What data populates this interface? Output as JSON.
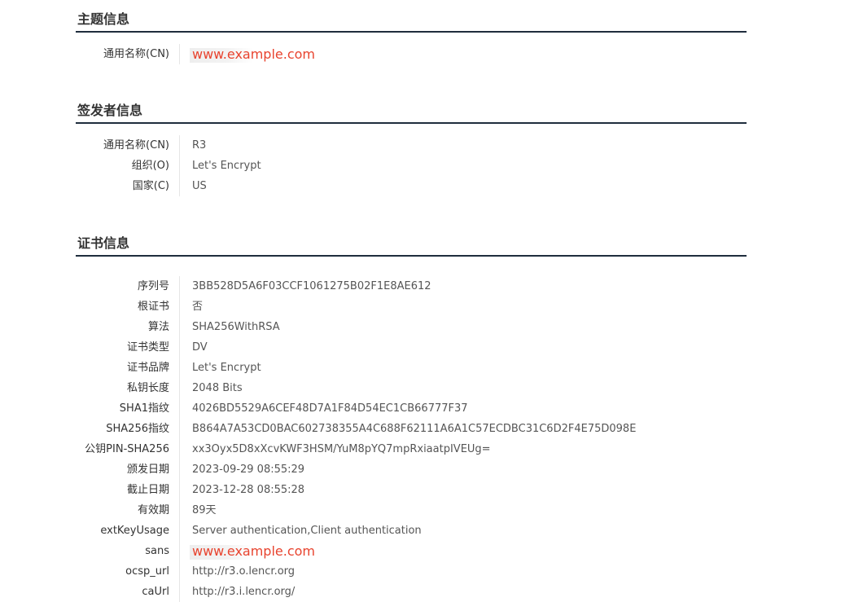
{
  "subject": {
    "title": "主题信息",
    "rows": [
      {
        "label": "通用名称(CN)",
        "value": "www.example.com"
      }
    ]
  },
  "issuer": {
    "title": "签发者信息",
    "rows": [
      {
        "label": "通用名称(CN)",
        "value": "R3"
      },
      {
        "label": "组织(O)",
        "value": "Let's Encrypt"
      },
      {
        "label": "国家(C)",
        "value": "US"
      }
    ]
  },
  "certificate": {
    "title": "证书信息",
    "rows": [
      {
        "label": "序列号",
        "value": "3BB528D5A6F03CCF1061275B02F1E8AE612"
      },
      {
        "label": "根证书",
        "value": "否"
      },
      {
        "label": "算法",
        "value": "SHA256WithRSA"
      },
      {
        "label": "证书类型",
        "value": "DV"
      },
      {
        "label": "证书品牌",
        "value": "Let's Encrypt"
      },
      {
        "label": "私钥长度",
        "value": "2048 Bits"
      },
      {
        "label": "SHA1指纹",
        "value": "4026BD5529A6CEF48D7A1F84D54EC1CB66777F37"
      },
      {
        "label": "SHA256指纹",
        "value": "B864A7A53CD0BAC602738355A4C688F62111A6A1C57ECDBC31C6D2F4E75D098E"
      },
      {
        "label": "公钥PIN-SHA256",
        "value": "xx3Oyx5D8xXcvKWF3HSM/YuM8pYQ7mpRxiaatpIVEUg="
      },
      {
        "label": "颁发日期",
        "value": "2023-09-29 08:55:29"
      },
      {
        "label": "截止日期",
        "value": "2023-12-28 08:55:28"
      },
      {
        "label": "有效期",
        "value": "89天"
      },
      {
        "label": "extKeyUsage",
        "value": "Server authentication,Client authentication"
      },
      {
        "label": "sans",
        "value": "www.example.com"
      },
      {
        "label": "ocsp_url",
        "value": "http://r3.o.lencr.org"
      },
      {
        "label": "caUrl",
        "value": "http://r3.i.lencr.org/"
      }
    ]
  }
}
